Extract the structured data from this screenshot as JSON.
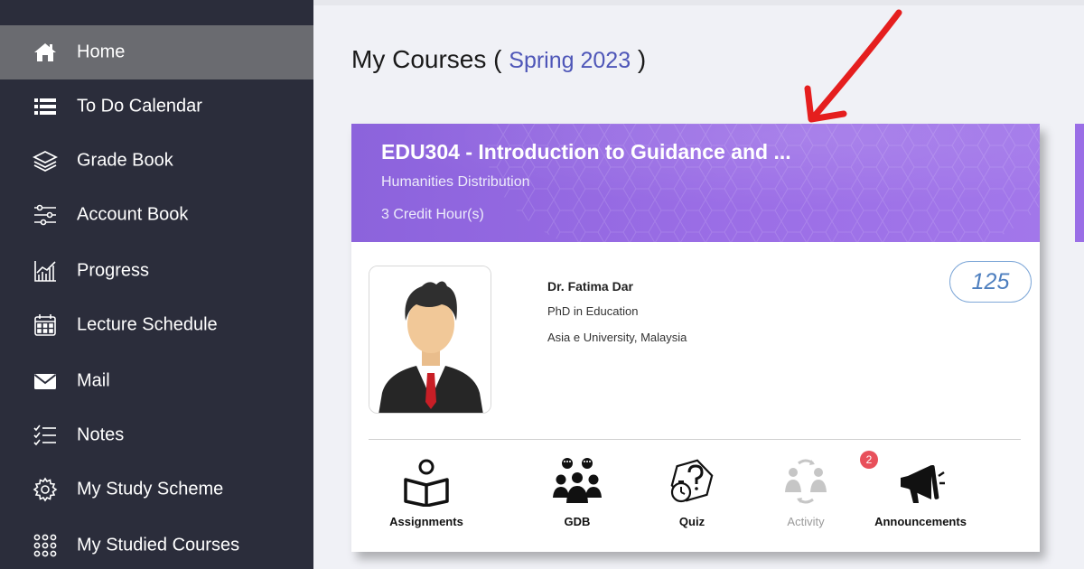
{
  "sidebar": {
    "items": [
      {
        "label": "Home",
        "icon": "home-icon",
        "active": true
      },
      {
        "label": "To Do Calendar",
        "icon": "list-icon"
      },
      {
        "label": "Grade Book",
        "icon": "layers-icon"
      },
      {
        "label": "Account Book",
        "icon": "sliders-icon"
      },
      {
        "label": "Progress",
        "icon": "chart-icon"
      },
      {
        "label": "Lecture Schedule",
        "icon": "calendar-icon"
      },
      {
        "label": "Mail",
        "icon": "mail-icon"
      },
      {
        "label": "Notes",
        "icon": "checklist-icon"
      },
      {
        "label": "My Study Scheme",
        "icon": "gear-icon"
      },
      {
        "label": "My Studied Courses",
        "icon": "grid-icon"
      }
    ]
  },
  "main": {
    "title": "My Courses",
    "paren_open": "(",
    "term": "Spring 2023",
    "paren_close": ")"
  },
  "course": {
    "title": "EDU304 - Introduction to Guidance and ...",
    "category": "Humanities Distribution",
    "credit": "3 Credit Hour(s)",
    "instructor_name": "Dr. Fatima Dar",
    "instructor_degree": "PhD in Education",
    "instructor_university": "Asia e University, Malaysia",
    "count": "125",
    "tools": [
      {
        "label": "Assignments",
        "icon": "book-reader-icon"
      },
      {
        "label": "GDB",
        "icon": "group-discussion-icon"
      },
      {
        "label": "Quiz",
        "icon": "quiz-icon"
      },
      {
        "label": "Activity",
        "icon": "activity-icon",
        "disabled": true
      },
      {
        "label": "Announcements",
        "icon": "megaphone-icon"
      }
    ],
    "announcement_badge": "2"
  },
  "colors": {
    "sidebar_bg": "#2b2d3b",
    "active_item": "#6a6b70",
    "header_purple": "#9b6ee6",
    "term_blue": "#4e56b8",
    "badge_red": "#e8505b",
    "arrow_red": "#e51e1e"
  }
}
